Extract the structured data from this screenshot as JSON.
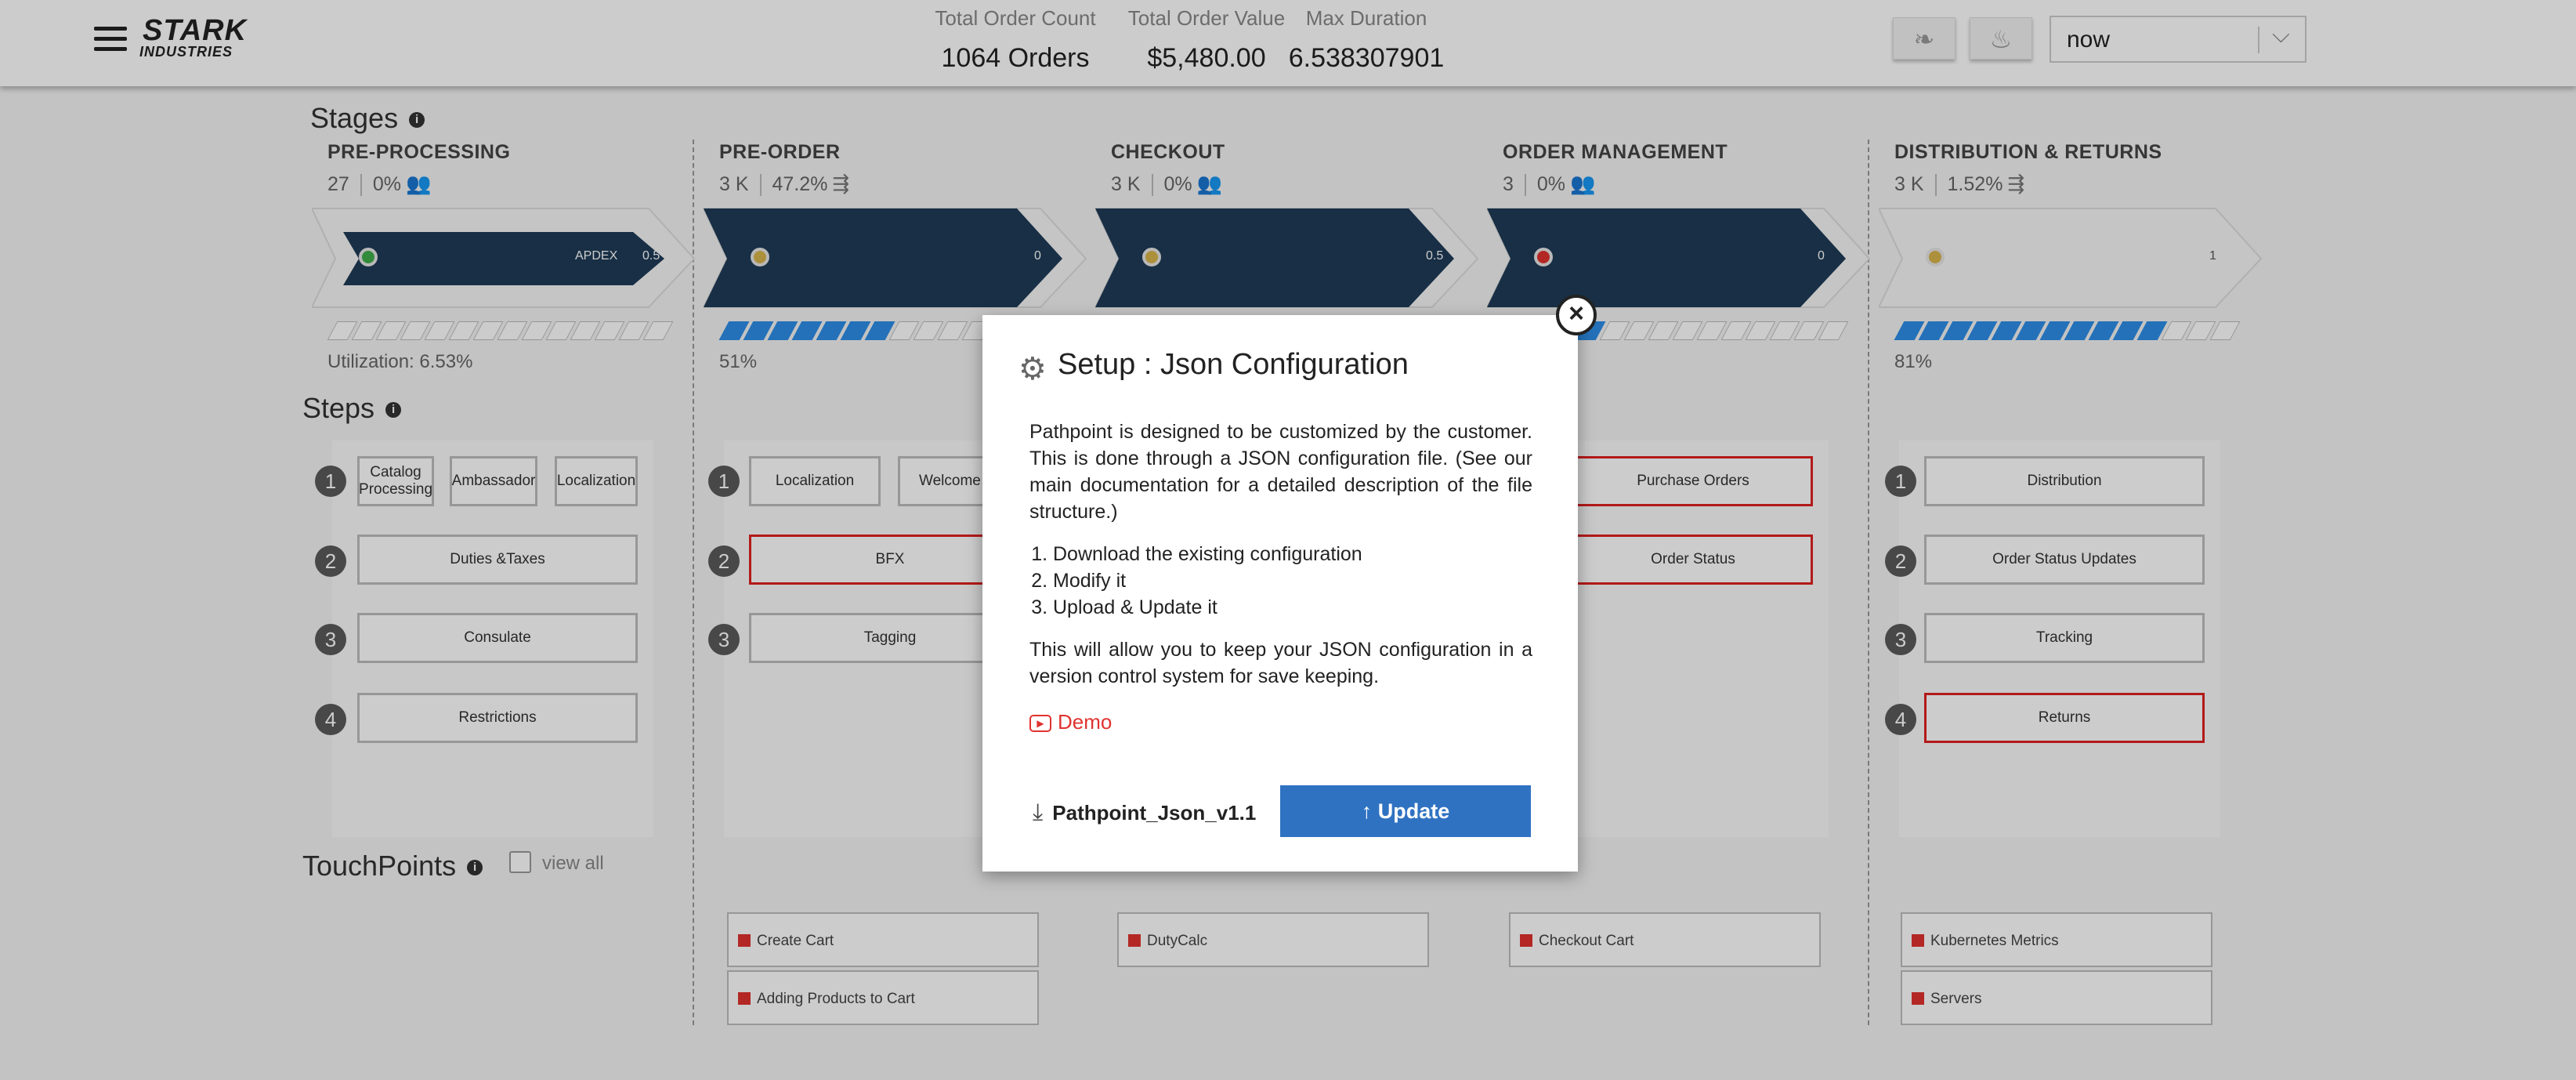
{
  "header": {
    "logo_line1": "STARK",
    "logo_line2": "INDUSTRIES",
    "kpis": [
      {
        "label": "Total Order Count",
        "value": "1064 Orders"
      },
      {
        "label": "Total Order Value",
        "value": "$5,480.00"
      },
      {
        "label": "Max Duration",
        "value": "6.538307901"
      }
    ],
    "time_select": "now"
  },
  "sections": {
    "stages": "Stages",
    "steps": "Steps",
    "touchpoints": "TouchPoints",
    "view_all": "view all"
  },
  "stages": [
    {
      "title": "PRE-PROCESSING",
      "count": "27",
      "pct": "0%",
      "arrow_label": "APDEX",
      "arrow_value": "0.5",
      "node_color": "#3fae49",
      "progress_pct": 0,
      "footer": "Utilization: 6.53%"
    },
    {
      "title": "PRE-ORDER",
      "count": "3 K",
      "pct": "47.2%",
      "arrow_label": "",
      "arrow_value": "0",
      "node_color": "#d9b44a",
      "progress_pct": 51,
      "footer": "51%"
    },
    {
      "title": "CHECKOUT",
      "count": "3 K",
      "pct": "0%",
      "arrow_label": "",
      "arrow_value": "0.5",
      "node_color": "#d9b44a",
      "progress_pct": null,
      "footer": ""
    },
    {
      "title": "ORDER MANAGEMENT",
      "count": "3",
      "pct": "0%",
      "arrow_label": "",
      "arrow_value": "0",
      "node_color": "#e0332f",
      "progress_pct": 30,
      "footer": ""
    },
    {
      "title": "DISTRIBUTION & RETURNS",
      "count": "3 K",
      "pct": "1.52%",
      "arrow_label": "",
      "arrow_value": "1",
      "node_color": "#d9b44a",
      "progress_pct": 81,
      "footer": "81%"
    }
  ],
  "steps": {
    "col0": {
      "rows": [
        {
          "num": "1",
          "items": [
            "Catalog Processing",
            "Ambassador",
            "Localization"
          ]
        },
        {
          "num": "2",
          "items": [
            "Duties &Taxes"
          ]
        },
        {
          "num": "3",
          "items": [
            "Consulate"
          ]
        },
        {
          "num": "4",
          "items": [
            "Restrictions"
          ]
        }
      ]
    },
    "col1": {
      "rows": [
        {
          "num": "1",
          "items": [
            "Localization",
            "Welcome"
          ]
        },
        {
          "num": "2",
          "items": [
            "BFX"
          ]
        },
        {
          "num": "3",
          "items": [
            "Tagging"
          ]
        }
      ]
    },
    "col3": {
      "items": [
        "Purchase Orders",
        "Order Status"
      ]
    },
    "col4": {
      "rows": [
        {
          "num": "1",
          "items": [
            "Distribution"
          ]
        },
        {
          "num": "2",
          "items": [
            "Order Status Updates"
          ]
        },
        {
          "num": "3",
          "items": [
            "Tracking"
          ]
        },
        {
          "num": "4",
          "items": [
            "Returns"
          ]
        }
      ]
    }
  },
  "touchpoints": [
    "Create Cart",
    "Adding Products to Cart",
    "DutyCalc",
    "Checkout Cart",
    "Kubernetes Metrics",
    "Servers"
  ],
  "modal": {
    "close": "×",
    "title": "Setup : Json Configuration",
    "para1": "Pathpoint is designed to be customized by the customer. This is done through a JSON configuration file. (See our main documentation for a detailed description of the file structure.)",
    "list": [
      "Download the existing configuration",
      "Modify it",
      "Upload & Update it"
    ],
    "para2": "This will allow you to keep your JSON configuration in a version control system for save keeping.",
    "demo": "Demo",
    "download_name": "Pathpoint_Json_v1.1",
    "update_button": "↑ Update"
  },
  "colors": {
    "arrow": "#1f3b57",
    "accent_blue": "#2f72c2",
    "progress_blue": "#2d8ee8",
    "red": "#e0332f"
  },
  "icons": {
    "menu": "hamburger-icon",
    "hdr1": "feather-icon",
    "hdr2": "flame-icon",
    "gear": "gear-icon",
    "download": "download-icon",
    "info": "info-icon"
  }
}
